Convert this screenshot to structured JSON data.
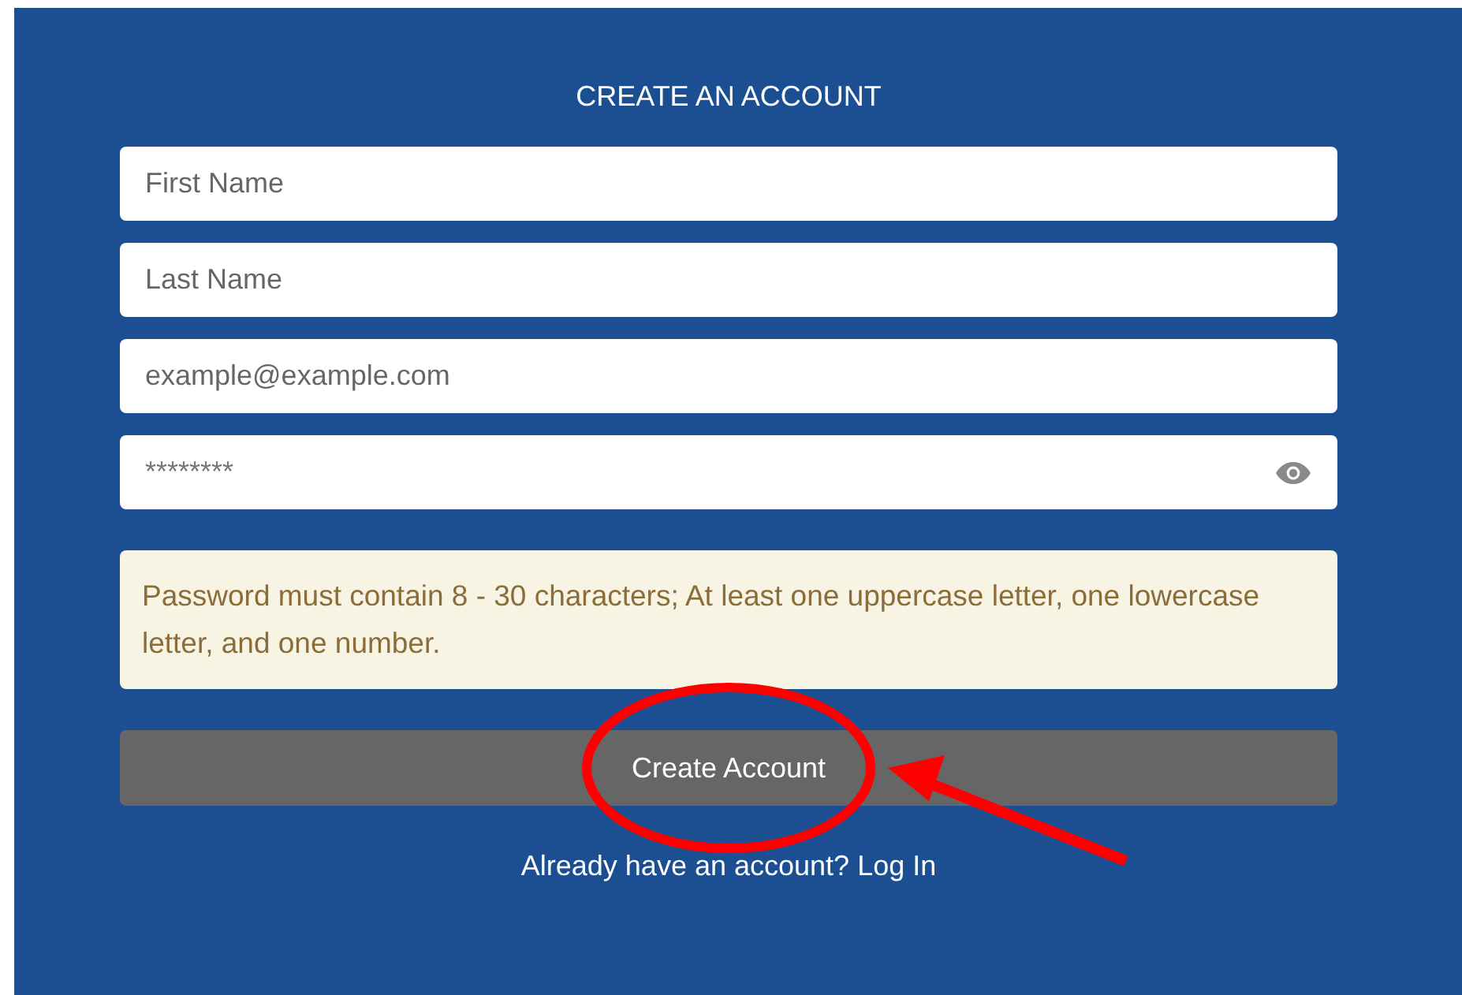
{
  "title": "CREATE AN ACCOUNT",
  "fields": [
    {
      "kind": "text",
      "placeholder": "First Name"
    },
    {
      "kind": "text",
      "placeholder": "Last Name"
    },
    {
      "kind": "email",
      "placeholder": "example@example.com"
    },
    {
      "kind": "password",
      "placeholder": "********"
    }
  ],
  "notice": "Password must contain 8 - 30 characters; At least one uppercase letter, one lowercase letter, and one number.",
  "submit": {
    "label": "Create Account",
    "disabled": true
  },
  "login": {
    "prompt": "Already have an account?",
    "link": "Log In"
  }
}
